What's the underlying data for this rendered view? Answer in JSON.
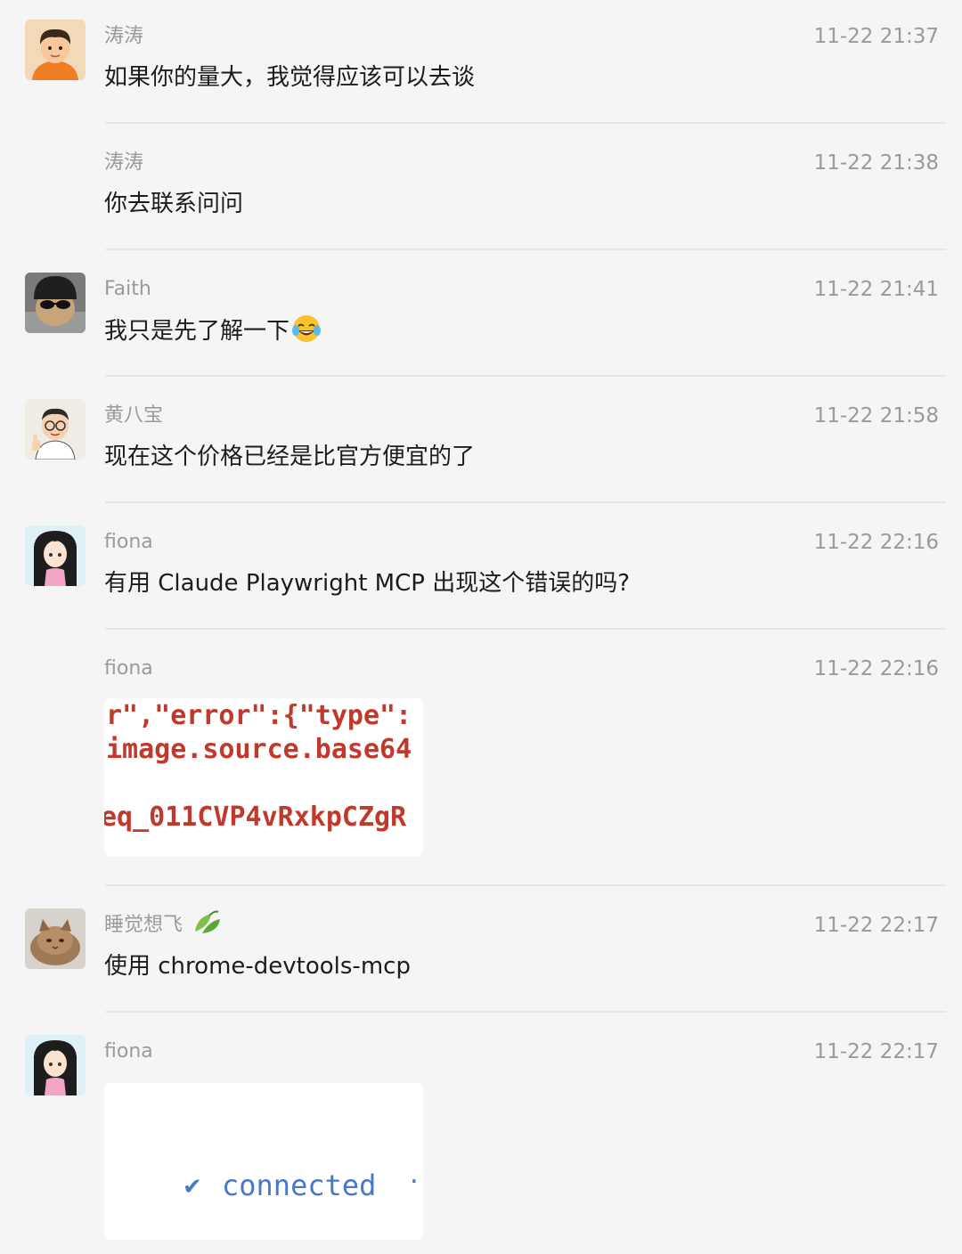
{
  "messages": [
    {
      "name": "涛涛",
      "time": "11-22 21:37",
      "text": "如果你的量大，我觉得应该可以去谈",
      "avatar": "boy-orange-avatar"
    },
    {
      "name": "涛涛",
      "time": "11-22 21:38",
      "text": "你去联系问问"
    },
    {
      "name": "Faith",
      "time": "11-22 21:41",
      "text": "我只是先了解一下",
      "emoji": "tears-of-joy-emoji",
      "avatar": "sunglasses-hat-avatar"
    },
    {
      "name": "黄八宝",
      "time": "11-22 21:58",
      "text": "现在这个价格已经是比官方便宜的了",
      "avatar": "glasses-man-thumbsup-avatar"
    },
    {
      "name": "fiona",
      "time": "11-22 22:16",
      "text": "有用 Claude Playwright MCP 出现这个错误的吗?",
      "avatar": "anime-girl-avatar"
    },
    {
      "name": "fiona",
      "time": "11-22 22:16",
      "image_lines": [
        "r\",\"error\":{\"type\":",
        "image.source.base64",
        "eq_011CVP4vRxkpCZgR"
      ]
    },
    {
      "name": "睡觉想飞",
      "name_icon": "leaf-cucumber-icon",
      "time": "11-22 22:17",
      "text": "使用 chrome-devtools-mcp",
      "avatar": "cat-avatar"
    },
    {
      "name": "fiona",
      "time": "11-22 22:17",
      "image_text": "connected",
      "image_check": "✔",
      "image_trailing": "·",
      "avatar": "anime-girl-avatar"
    }
  ],
  "colors": {
    "background": "#f5f5f5",
    "name": "#9a9a9a",
    "time": "#9a9a9a",
    "text": "#1c1c1c",
    "error_red": "#c0392b",
    "connected_blue": "#4a78c8"
  }
}
